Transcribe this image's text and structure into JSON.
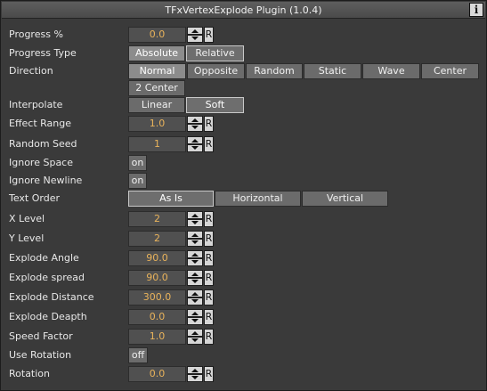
{
  "window": {
    "title": "TFxVertexExplode Plugin (1.0.4)",
    "info_label": "i"
  },
  "fields": {
    "progress_pct": {
      "label": "Progress %",
      "value": "0.0",
      "reset": "R"
    },
    "effect_range": {
      "label": "Effect Range",
      "value": "1.0",
      "reset": "R"
    },
    "random_seed": {
      "label": "Random Seed",
      "value": "1",
      "reset": "R"
    },
    "x_level": {
      "label": "X Level",
      "value": "2",
      "reset": "R"
    },
    "y_level": {
      "label": "Y Level",
      "value": "2",
      "reset": "R"
    },
    "explode_angle": {
      "label": "Explode Angle",
      "value": "90.0",
      "reset": "R"
    },
    "explode_spread": {
      "label": "Explode spread",
      "value": "90.0",
      "reset": "R"
    },
    "explode_distance": {
      "label": "Explode Distance",
      "value": "300.0",
      "reset": "R"
    },
    "explode_deapth": {
      "label": "Explode Deapth",
      "value": "0.0",
      "reset": "R"
    },
    "speed_factor": {
      "label": "Speed Factor",
      "value": "1.0",
      "reset": "R"
    },
    "rotation": {
      "label": "Rotation",
      "value": "0.0",
      "reset": "R"
    }
  },
  "progress_type": {
    "label": "Progress Type",
    "options": [
      "Absolute",
      "Relative"
    ],
    "selected": "Absolute"
  },
  "direction": {
    "label": "Direction",
    "options": [
      "Normal",
      "Opposite",
      "Random",
      "Static",
      "Wave",
      "Center",
      "2 Center"
    ],
    "selected": "Normal"
  },
  "interpolate": {
    "label": "Interpolate",
    "options": [
      "Linear",
      "Soft"
    ],
    "selected": "Soft"
  },
  "text_order": {
    "label": "Text Order",
    "options": [
      "As Is",
      "Horizontal",
      "Vertical"
    ],
    "selected": "As Is"
  },
  "toggles": {
    "ignore_space": {
      "label": "Ignore Space",
      "value": "on"
    },
    "ignore_newline": {
      "label": "Ignore Newline",
      "value": "on"
    },
    "use_rotation": {
      "label": "Use Rotation",
      "value": "off"
    }
  },
  "colors": {
    "panel_bg": "#3a3a3a",
    "value_text": "#e9b35b",
    "button_bg": "#6b6b6b",
    "selected_bg": "#8c8c8c"
  }
}
